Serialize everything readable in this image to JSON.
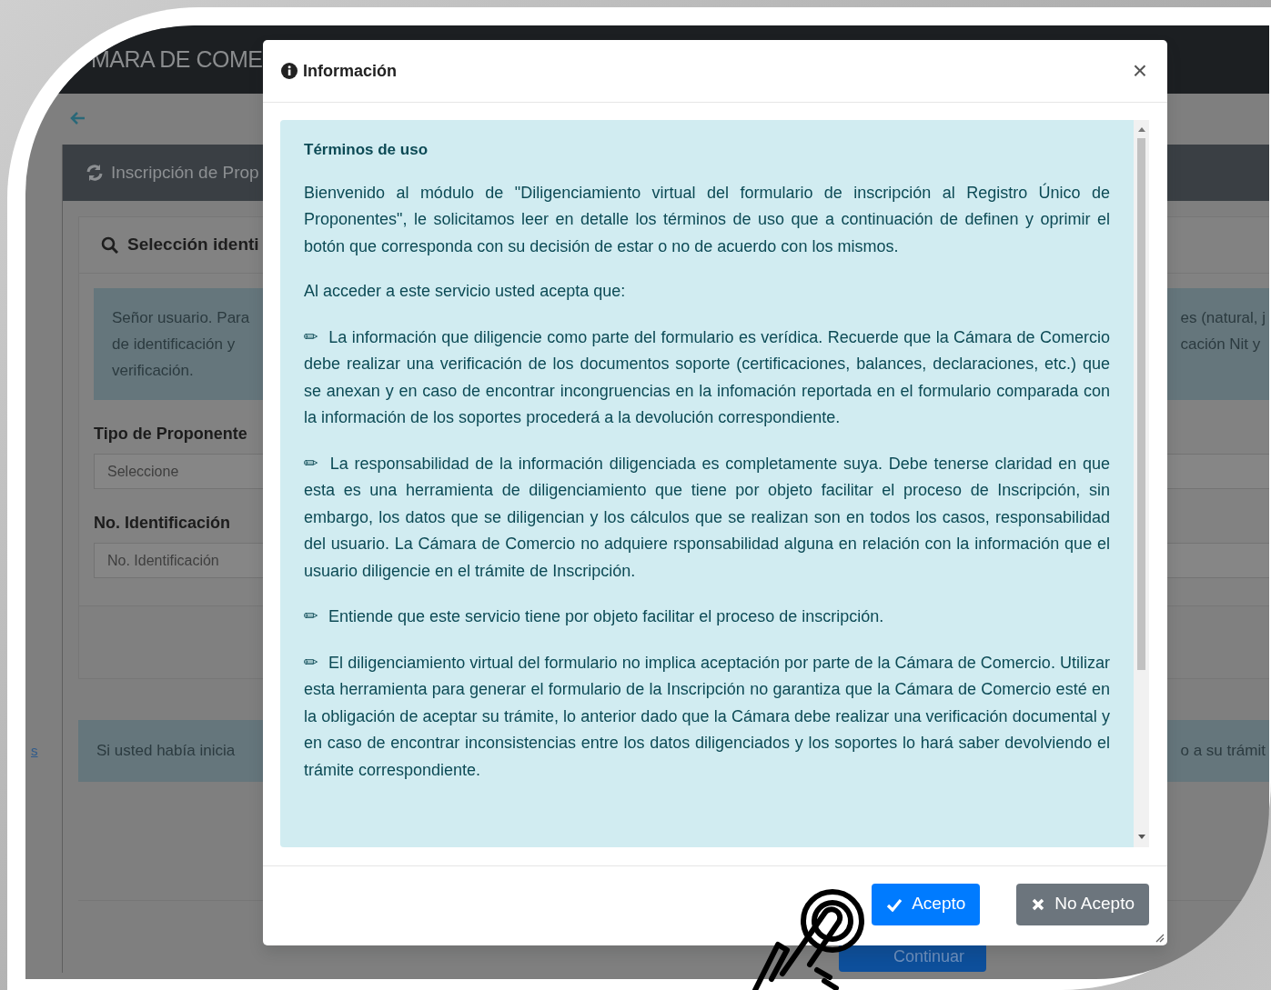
{
  "navbar": {
    "title": "MARA DE COME"
  },
  "page": {
    "card_title": "Inscripción de Prop",
    "section_title": "Selección identi",
    "notice": {
      "left_lines": [
        "Señor usuario. Para",
        "de identificación y",
        "verificación."
      ],
      "right_lines": [
        "es (natural, j",
        "cación Nit y"
      ]
    },
    "fields": [
      {
        "label": "Tipo de Proponente",
        "placeholder": "Seleccione"
      },
      {
        "label": "No. Identificación",
        "placeholder": "No. Identificación"
      }
    ],
    "side_link": "s",
    "resume_notice": {
      "left": "Si usted había inicia",
      "right": "o a su trámit"
    },
    "continue_button": "Continuar"
  },
  "modal": {
    "title": "Información",
    "close": "×",
    "heading": "Términos de uso",
    "intro": [
      "Bienvenido al módulo de \"Diligenciamiento virtual del formulario de inscripción al Registro Único de Proponentes\", le solicitamos leer en detalle los términos de uso que a continuación de definen y oprimir el botón que corresponda con su decisión de estar o no de acuerdo con los mismos.",
      "Al acceder a este servicio usted acepta que:"
    ],
    "term_icon": "✏",
    "terms": [
      "La información que diligencie como parte del formulario es verídica. Recuerde que la Cámara de Comercio debe realizar una verificación de los documentos soporte (certificaciones, balances, declaraciones, etc.) que se anexan y en caso de encontrar incongruencias en la infomación reportada en el formulario comparada con la información de los soportes procederá a la devolución correspondiente.",
      "La responsabilidad de la información diligenciada es completamente suya. Debe tenerse claridad en que esta es una herramienta de diligenciamiento que tiene por objeto facilitar el proceso de Inscripción, sin embargo, los datos que se diligencian y los cálculos que se realizan son en todos los casos, responsabilidad del usuario. La Cámara de Comercio no adquiere rsponsabilidad alguna en relación con la información que el usuario diligencie en el trámite de Inscripción.",
      "Entiende que este servicio tiene por objeto facilitar el proceso de inscripción.",
      "El diligenciamiento virtual del formulario no implica aceptación por parte de la Cámara de Comercio. Utilizar esta herramienta para generar el formulario de la Inscripción no garantiza que la Cámara de Comercio esté en la obligación de aceptar su trámite, lo anterior dado que la Cámara debe realizar una verificación documental y en caso de encontrar inconsistencias entre los datos diligenciados y los soportes lo hará saber devolviendo el trámite correspondiente."
    ],
    "buttons": [
      {
        "label": "Acepto",
        "kind": "primary"
      },
      {
        "label": "No Acepto",
        "kind": "secondary"
      }
    ]
  }
}
